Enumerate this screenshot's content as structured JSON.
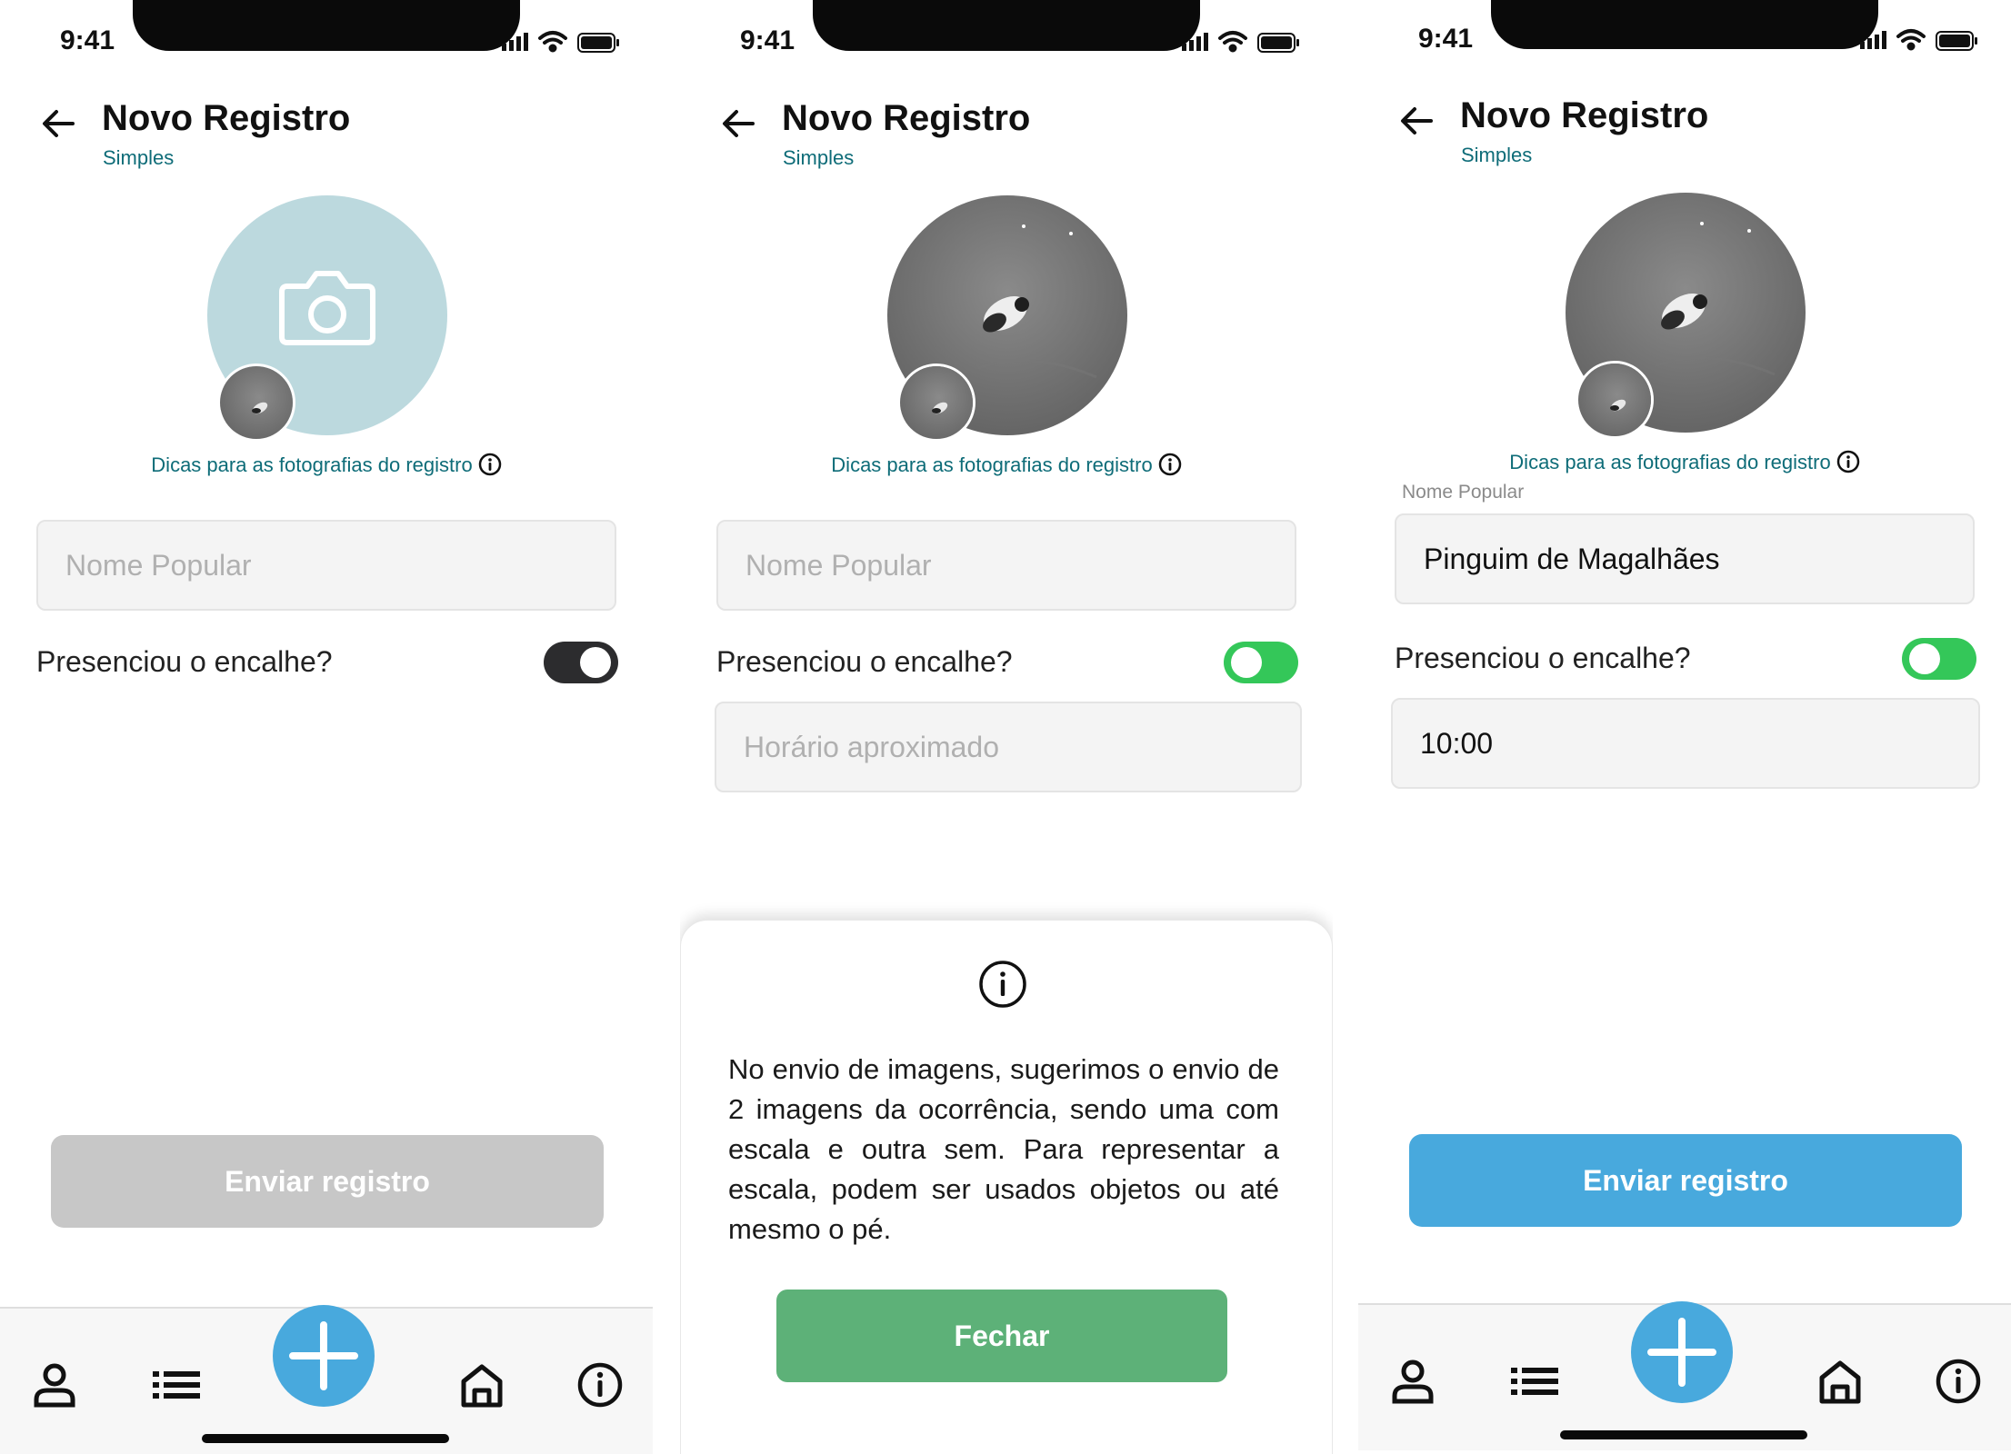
{
  "status": {
    "time": "9:41"
  },
  "header": {
    "title": "Novo Registro",
    "subtitle": "Simples"
  },
  "tips": {
    "label": "Dicas para as fotografias do registro"
  },
  "form": {
    "name_placeholder": "Nome Popular",
    "name_label": "Nome Popular",
    "name_value": "Pinguim de Magalhães",
    "witnessed_label": "Presenciou o encalhe?",
    "time_placeholder": "Horário aproximado",
    "time_value": "10:00"
  },
  "screens": [
    {
      "witnessed_toggle": "off",
      "submit_state": "disabled",
      "photo": "camera-placeholder"
    },
    {
      "witnessed_toggle": "on",
      "photo": "penguin-photo",
      "modal_open": true
    },
    {
      "witnessed_toggle": "on",
      "submit_state": "active",
      "photo": "penguin-photo"
    }
  ],
  "submit": {
    "label": "Enviar registro"
  },
  "modal": {
    "text": "No envio de imagens, sugerimos o envio de 2 imagens da ocorrência, sendo uma com escala e outra sem. Para representar a escala, podem ser usados objetos ou até mesmo o pé.",
    "close_label": "Fechar"
  },
  "tabbar": {
    "items": [
      "profile-icon",
      "list-icon",
      "add-icon",
      "home-icon",
      "info-icon"
    ]
  },
  "colors": {
    "accent_blue": "#48a9dd",
    "teal_text": "#0e6c78",
    "toggle_on": "#34c759",
    "close_green": "#5db178",
    "disabled_gray": "#c7c7c7",
    "placeholder_circle": "#bcd9de"
  }
}
